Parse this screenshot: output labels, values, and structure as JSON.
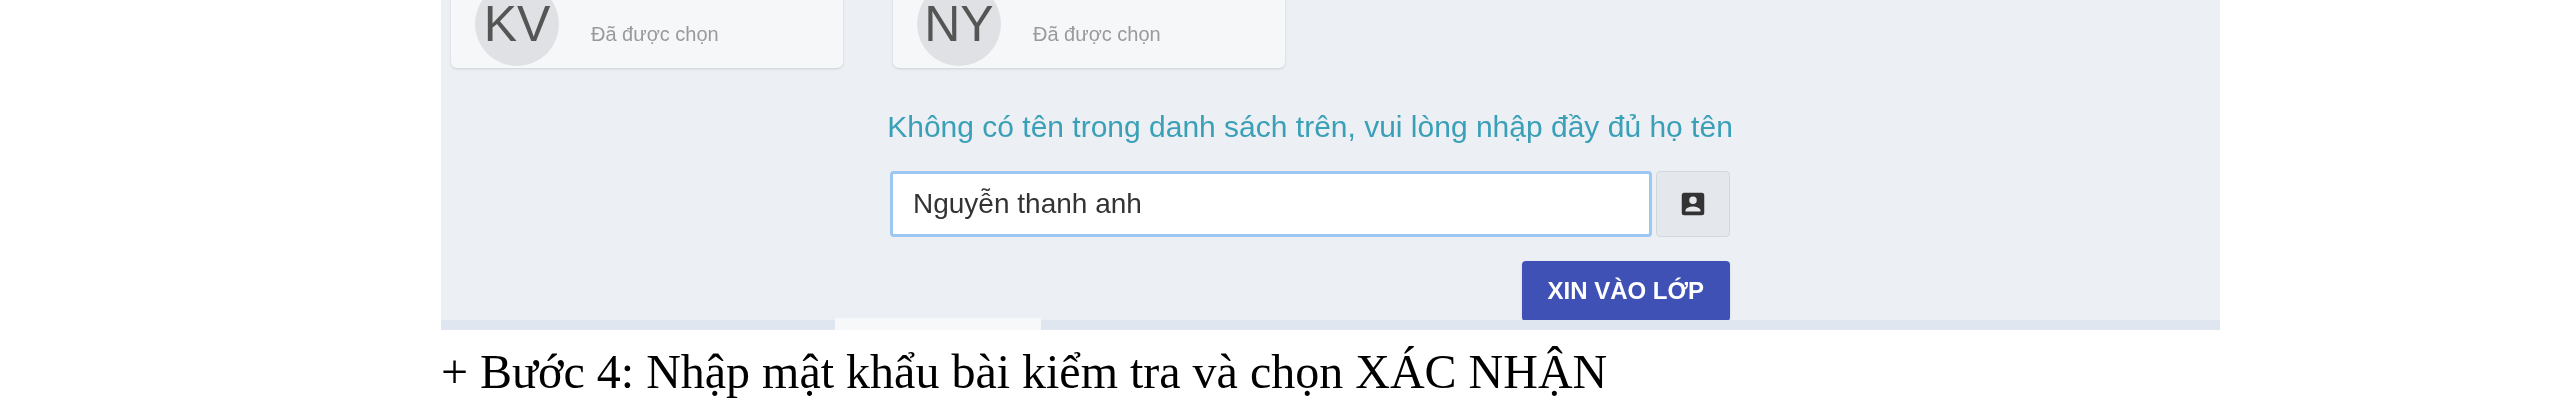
{
  "students": [
    {
      "initials": "KV",
      "status": "Đã được chọn"
    },
    {
      "initials": "NY",
      "status": "Đã được chọn"
    }
  ],
  "prompt": "Không có tên trong danh sách trên, vui lòng nhập đầy đủ họ tên",
  "name_field": {
    "value": "Nguyễn thanh anh"
  },
  "submit_button": "XIN VÀO LỚP",
  "caption": "+ Bước 4: Nhập mật khẩu bài kiểm tra và chọn XÁC NHẬN"
}
